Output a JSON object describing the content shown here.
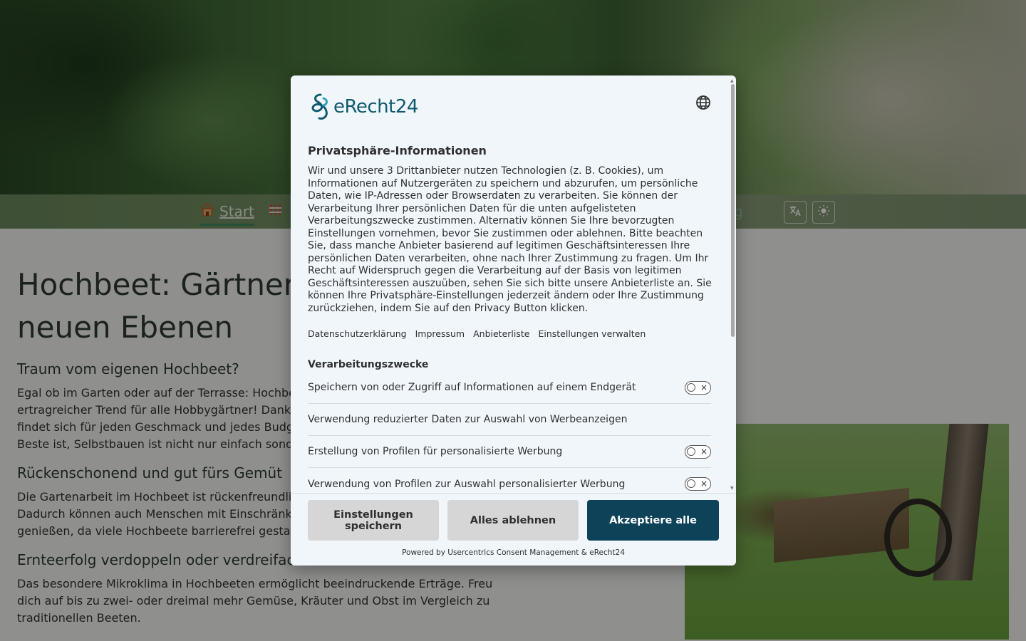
{
  "page": {
    "nav": {
      "start_label": "Start",
      "start_icon": "house-icon",
      "second_icon": "fence-icon",
      "partial_item": "g",
      "translate_icon": "translate-icon",
      "theme_icon": "sun-icon"
    },
    "headline": "Hochbeet: Gärtnerg",
    "headline_line2": "neuen Ebenen",
    "sections": [
      {
        "heading": "Traum vom eigenen Hochbeet?",
        "lines": [
          "Egal ob im Garten oder auf der Terrasse: Hochbe",
          "ertragreicher Trend für alle Hobbygärtner! Dank",
          "findet sich für jeden Geschmack und jedes Budg",
          "Beste ist, Selbstbauen ist nicht nur einfach sond"
        ]
      },
      {
        "heading": "Rückenschonend und gut fürs Gemüt",
        "lines": [
          "Die Gartenarbeit im Hochbeet ist rückenfreundli",
          "Dadurch können auch Menschen mit Einschränk",
          "genießen, da viele Hochbeete barrierefrei gesta"
        ]
      },
      {
        "heading": "Ernteerfolg verdoppeln oder verdreifac",
        "lines": [
          "Das besondere Mikroklima in Hochbeeten ermöglicht beeindruckende Erträge. Freu",
          "dich auf bis zu zwei- oder dreimal mehr Gemüse, Kräuter und Obst im Vergleich zu",
          "traditionellen Beeten."
        ]
      }
    ]
  },
  "consent": {
    "brand": "eRecht24",
    "language_icon": "globe-icon",
    "title": "Privatsphäre-Informationen",
    "body": "Wir und unsere 3 Drittanbieter nutzen Technologien (z. B. Cookies), um Informationen auf Nutzergeräten zu speichern und abzurufen, um persönliche Daten, wie IP-Adressen oder Browserdaten zu verarbeiten. Sie können der Verarbeitung Ihrer persönlichen Daten für die unten aufgelisteten Verarbeitungszwecke zustimmen. Alternativ können Sie Ihre bevorzugten Einstellungen vornehmen, bevor Sie zustimmen oder ablehnen. Bitte beachten Sie, dass manche Anbieter basierend auf legitimen Geschäftsinteressen Ihre persönlichen Daten verarbeiten, ohne nach Ihrer Zustimmung zu fragen. Um Ihr Recht auf Widerspruch gegen die Verarbeitung auf der Basis von legitimen Geschäftsinteressen auszuüben, sehen Sie sich bitte unsere Anbieterliste an. Sie können Ihre Privatsphäre-Einstellungen jederzeit ändern oder Ihre Zustimmung zurückziehen, indem Sie auf den Privacy Button klicken.",
    "links": [
      "Datenschutzerklärung",
      "Impressum",
      "Anbieterliste",
      "Einstellungen verwalten"
    ],
    "purposes_title": "Verarbeitungszwecke",
    "purposes": [
      {
        "label": "Speichern von oder Zugriff auf Informationen auf einem Endgerät",
        "has_toggle": true,
        "enabled": false
      },
      {
        "label": "Verwendung reduzierter Daten zur Auswahl von Werbeanzeigen",
        "has_toggle": false,
        "enabled": false
      },
      {
        "label": "Erstellung von Profilen für personalisierte Werbung",
        "has_toggle": true,
        "enabled": false
      },
      {
        "label": "Verwendung von Profilen zur Auswahl personalisierter Werbung",
        "has_toggle": true,
        "enabled": false
      }
    ],
    "toggle_off_symbol": "×",
    "buttons": {
      "save_line1": "Einstellungen",
      "save_line2": "speichern",
      "deny": "Alles ablehnen",
      "accept": "Akzeptiere alle"
    },
    "powered_by": "Powered by Usercentrics Consent Management & eRecht24",
    "colors": {
      "accept_bg": "#0d4259",
      "brand": "#0f5a6e",
      "modal_bg": "#f1f6fb"
    }
  }
}
